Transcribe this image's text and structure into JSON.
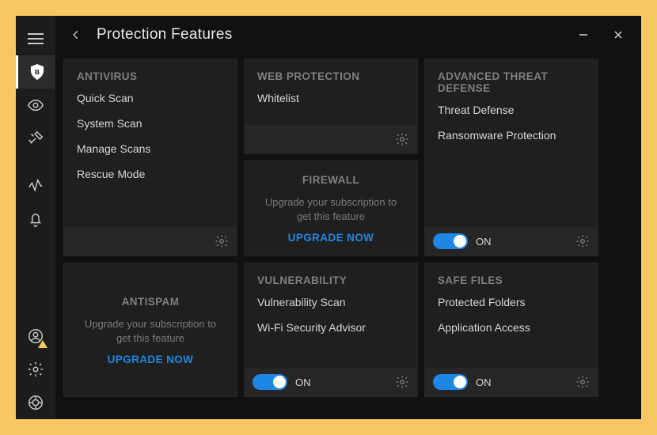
{
  "window": {
    "title": "Protection Features"
  },
  "sidebar": {
    "items": [
      {
        "name": "menu-icon"
      },
      {
        "name": "shield-icon",
        "active": true
      },
      {
        "name": "eye-icon"
      },
      {
        "name": "tools-icon"
      },
      {
        "name": "activity-icon"
      },
      {
        "name": "bell-icon"
      },
      {
        "name": "account-icon",
        "alert": true
      },
      {
        "name": "settings-icon"
      },
      {
        "name": "help-icon"
      }
    ]
  },
  "cards": {
    "antivirus": {
      "title": "ANTIVIRUS",
      "items": [
        "Quick Scan",
        "System Scan",
        "Manage Scans",
        "Rescue Mode"
      ]
    },
    "web": {
      "title": "WEB PROTECTION",
      "items": [
        "Whitelist"
      ]
    },
    "firewall": {
      "title": "FIREWALL",
      "desc": "Upgrade your subscription to get this feature",
      "cta": "UPGRADE NOW"
    },
    "atd": {
      "title": "ADVANCED THREAT DEFENSE",
      "items": [
        "Threat Defense",
        "Ransomware Protection"
      ],
      "toggle": {
        "state": "on",
        "label": "ON"
      }
    },
    "antispam": {
      "title": "ANTISPAM",
      "desc": "Upgrade your subscription to get this feature",
      "cta": "UPGRADE NOW"
    },
    "vuln": {
      "title": "VULNERABILITY",
      "items": [
        "Vulnerability Scan",
        "Wi-Fi Security Advisor"
      ],
      "toggle": {
        "state": "on",
        "label": "ON"
      }
    },
    "safefiles": {
      "title": "SAFE FILES",
      "items": [
        "Protected Folders",
        "Application Access"
      ],
      "toggle": {
        "state": "on",
        "label": "ON"
      }
    }
  }
}
